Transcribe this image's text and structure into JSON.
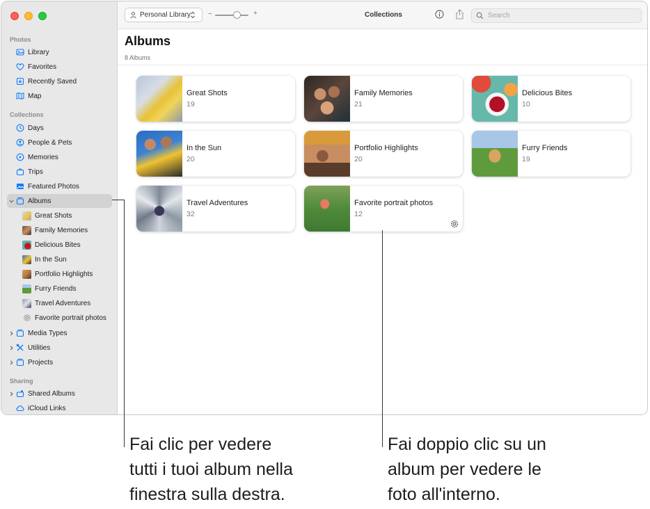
{
  "window": {
    "toolbar": {
      "library_label": "Personal Library",
      "zoom_minus": "−",
      "zoom_plus": "+",
      "title": "Collections",
      "search_placeholder": "Search"
    },
    "sidebar": {
      "sections": {
        "photos": "Photos",
        "collections": "Collections",
        "sharing": "Sharing"
      },
      "items": {
        "library": "Library",
        "favorites": "Favorites",
        "recently_saved": "Recently Saved",
        "map": "Map",
        "days": "Days",
        "people_pets": "People & Pets",
        "memories": "Memories",
        "trips": "Trips",
        "featured_photos": "Featured Photos",
        "albums": "Albums",
        "great_shots": "Great Shots",
        "family_memories": "Family Memories",
        "delicious_bites": "Delicious Bites",
        "in_the_sun": "In the Sun",
        "portfolio_highlights": "Portfolio Highlights",
        "furry_friends": "Furry Friends",
        "travel_adventures": "Travel Adventures",
        "favorite_portrait_photos": "Favorite portrait photos",
        "media_types": "Media Types",
        "utilities": "Utilities",
        "projects": "Projects",
        "shared_albums": "Shared Albums",
        "icloud_links": "iCloud Links"
      }
    },
    "main": {
      "title": "Albums",
      "subtitle": "8 Albums",
      "albums": [
        {
          "name": "Great Shots",
          "count": "19"
        },
        {
          "name": "Family Memories",
          "count": "21"
        },
        {
          "name": "Delicious Bites",
          "count": "10"
        },
        {
          "name": "In the Sun",
          "count": "20"
        },
        {
          "name": "Portfolio Highlights",
          "count": "20"
        },
        {
          "name": "Furry Friends",
          "count": "19"
        },
        {
          "name": "Travel Adventures",
          "count": "32"
        },
        {
          "name": "Favorite portrait photos",
          "count": "12"
        }
      ]
    }
  },
  "callouts": {
    "left": [
      "Fai clic per vedere",
      "tutti i tuoi album nella",
      "finestra sulla destra."
    ],
    "right": [
      "Fai doppio clic su un",
      "album per vedere le",
      "foto all'interno."
    ]
  },
  "colors": {
    "accent": "#0a7aff",
    "sidebar_bg": "#e8e8e8",
    "selected_bg": "#d2d2d2"
  }
}
